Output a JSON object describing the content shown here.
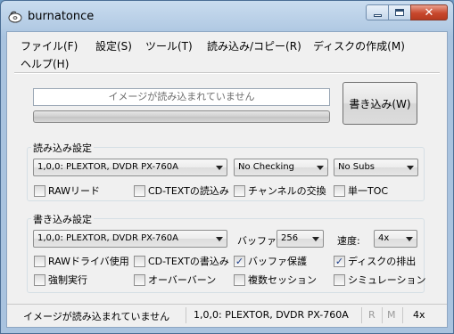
{
  "window": {
    "title": "burnatonce",
    "icon": "burn-disc-icon"
  },
  "menu": [
    "ファイル(F)",
    "設定(S)",
    "ツール(T)",
    "読み込み/コピー(R)",
    "ディスクの作成(M)",
    "ヘルプ(H)"
  ],
  "status_message": "イメージが読み込まれていません",
  "progress": {
    "fraction": 0.0
  },
  "write_button_label": "書き込み(W)",
  "read_settings": {
    "title": "読み込み設定",
    "drive": "1,0,0: PLEXTOR, DVDR   PX-760A",
    "check_mode": "No Checking",
    "subs_mode": "No Subs",
    "options": [
      {
        "label": "RAWリード",
        "checked": false
      },
      {
        "label": "CD-TEXTの読込み",
        "checked": false
      },
      {
        "label": "チャンネルの交換",
        "checked": false
      },
      {
        "label": "単一TOC",
        "checked": false
      }
    ]
  },
  "write_settings": {
    "title": "書き込み設定",
    "drive": "1,0,0: PLEXTOR, DVDR   PX-760A",
    "buffer_label": "バッファ:",
    "buffer_value": "256",
    "speed_label": "速度:",
    "speed_value": "4x",
    "options": [
      {
        "label": "RAWドライバ使用",
        "checked": false
      },
      {
        "label": "CD-TEXTの書込み",
        "checked": false
      },
      {
        "label": "バッファ保護",
        "checked": true
      },
      {
        "label": "ディスクの排出",
        "checked": true
      },
      {
        "label": "強制実行",
        "checked": false
      },
      {
        "label": "オーバーバーン",
        "checked": false
      },
      {
        "label": "複数セッション",
        "checked": false
      },
      {
        "label": "シミュレーション",
        "checked": false
      }
    ]
  },
  "statusbar": {
    "message": "イメージが読み込まれていません",
    "drive": "1,0,0: PLEXTOR, DVDR   PX-760A",
    "flag_r": "R",
    "flag_m": "M",
    "speed": "4x"
  }
}
